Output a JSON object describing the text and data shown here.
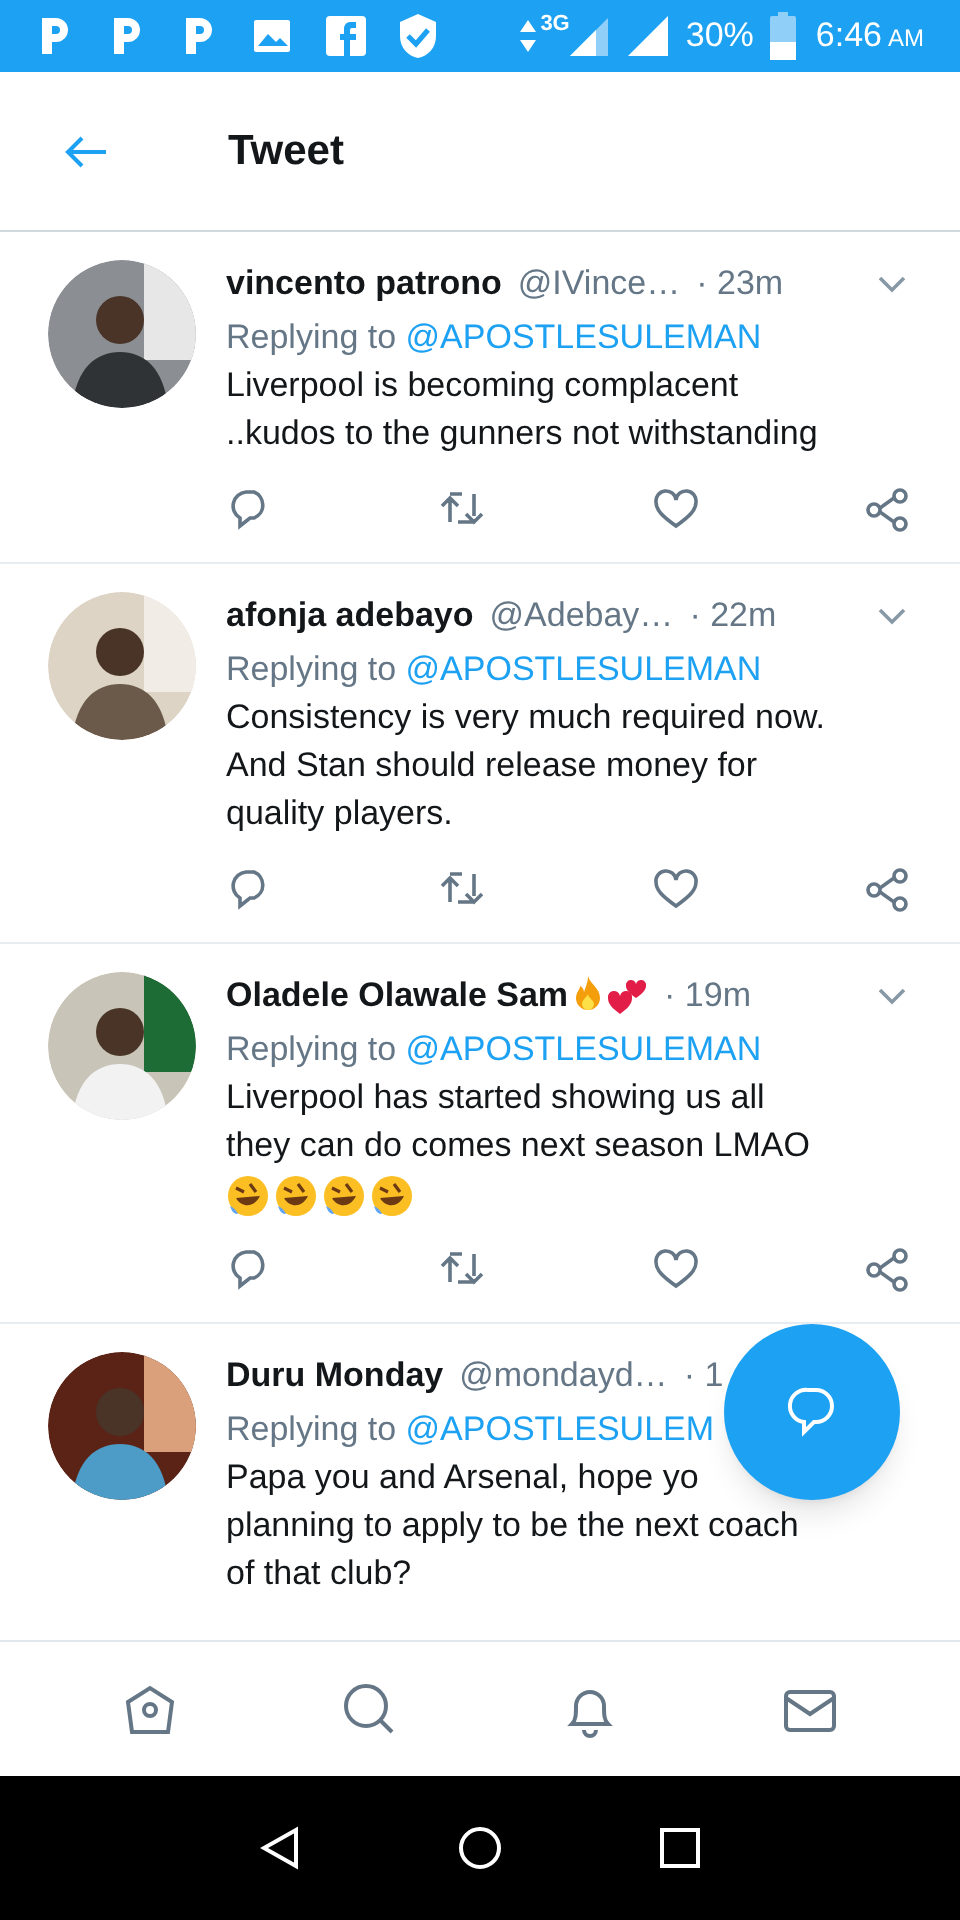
{
  "status_bar": {
    "network": "3G",
    "battery": "30%",
    "time": "6:46",
    "ampm": "AM"
  },
  "header": {
    "title": "Tweet"
  },
  "tweets": [
    {
      "name": "vincento patrono",
      "handle": "@IVince…",
      "time": "· 23m",
      "replying_label": "Replying to",
      "replying_to": "@APOSTLESULEMAN",
      "lines": [
        "Liverpool is becoming complacent",
        "..kudos to the gunners not withstanding"
      ]
    },
    {
      "name": "afonja adebayo",
      "handle": "@Adebay…",
      "time": "· 22m",
      "replying_label": "Replying to",
      "replying_to": "@APOSTLESULEMAN",
      "lines": [
        "Consistency is very much required now.",
        "And Stan should release money for",
        "quality players."
      ]
    },
    {
      "name": "Oladele Olawale Sam",
      "badges": [
        {
          "kind": "fire"
        },
        {
          "kind": "hearts"
        }
      ],
      "time": "· 19m",
      "replying_label": "Replying to",
      "replying_to": "@APOSTLESULEMAN",
      "lines": [
        "Liverpool has started showing us all",
        "they can do comes next season LMAO"
      ],
      "emojis": [
        {
          "kind": "rofl"
        },
        {
          "kind": "rofl"
        },
        {
          "kind": "rofl"
        },
        {
          "kind": "rofl"
        }
      ]
    },
    {
      "name": "Duru Monday",
      "handle": "@mondayd…",
      "time": "· 1",
      "replying_label": "Replying to",
      "replying_to": "@APOSTLESULEM",
      "lines": [
        "Papa you and Arsenal, hope yo",
        "planning to apply to be the next coach",
        "of that club?"
      ],
      "partial": true
    }
  ]
}
